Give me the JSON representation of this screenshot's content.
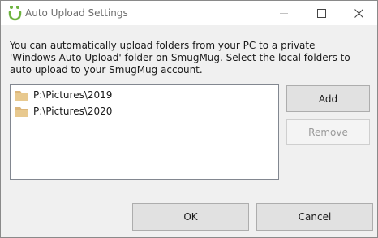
{
  "window": {
    "title": "Auto Upload Settings",
    "controls": {
      "minimize": "minimize-icon",
      "maximize": "maximize-icon",
      "close": "close-icon"
    }
  },
  "description": "You can automatically upload folders from your PC to a private 'Windows Auto Upload' folder on SmugMug. Select the local folders to auto upload to your SmugMug account.",
  "folders": [
    {
      "path": "P:\\Pictures\\2019",
      "icon": "folder-icon"
    },
    {
      "path": "P:\\Pictures\\2020",
      "icon": "folder-icon"
    }
  ],
  "buttons": {
    "add": "Add",
    "remove": "Remove",
    "ok": "OK",
    "cancel": "Cancel"
  },
  "colors": {
    "brand_green": "#6db33f",
    "folder": "#dcb67a"
  }
}
